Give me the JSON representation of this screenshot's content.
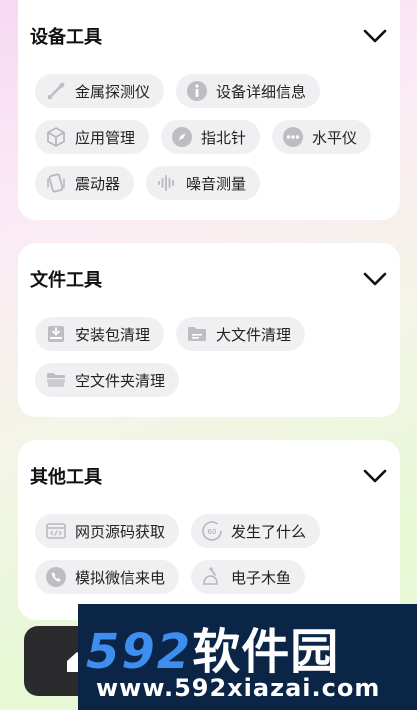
{
  "sections": [
    {
      "title": "设备工具",
      "items": [
        {
          "label": "金属探测仪",
          "icon": "metal-detector-icon"
        },
        {
          "label": "设备详细信息",
          "icon": "info-icon"
        },
        {
          "label": "应用管理",
          "icon": "cube-icon"
        },
        {
          "label": "指北针",
          "icon": "compass-icon"
        },
        {
          "label": "水平仪",
          "icon": "level-icon"
        },
        {
          "label": "震动器",
          "icon": "vibrate-icon"
        },
        {
          "label": "噪音测量",
          "icon": "sound-wave-icon"
        }
      ]
    },
    {
      "title": "文件工具",
      "items": [
        {
          "label": "安装包清理",
          "icon": "package-icon"
        },
        {
          "label": "大文件清理",
          "icon": "folder-icon"
        },
        {
          "label": "空文件夹清理",
          "icon": "empty-folder-icon"
        }
      ]
    },
    {
      "title": "其他工具",
      "items": [
        {
          "label": "网页源码获取",
          "icon": "code-icon"
        },
        {
          "label": "发生了什么",
          "icon": "clock-60-icon"
        },
        {
          "label": "模拟微信来电",
          "icon": "phone-icon"
        },
        {
          "label": "电子木鱼",
          "icon": "wooden-fish-icon"
        }
      ]
    }
  ],
  "watermark": {
    "numerals": "592",
    "brand": "软件园",
    "url": "www.592xiazai.com"
  },
  "colors": {
    "chip_bg": "#f0f0f2",
    "icon_gray": "#c4c4c8",
    "watermark_bg": "#0a2546",
    "watermark_accent": "#3e8ef0"
  }
}
